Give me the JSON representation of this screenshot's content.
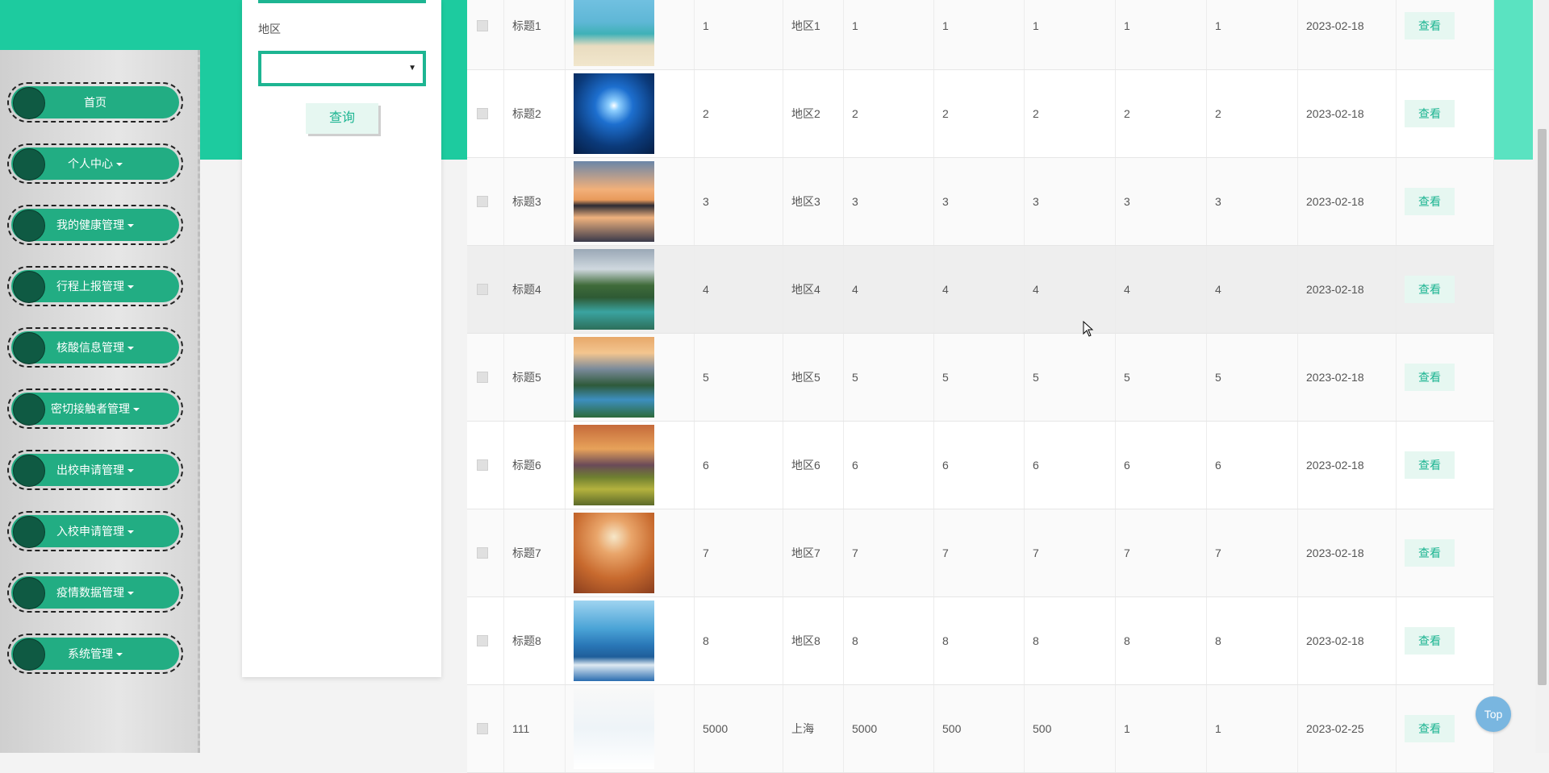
{
  "sidebar": {
    "items": [
      {
        "label": "首页",
        "dropdown": false
      },
      {
        "label": "个人中心",
        "dropdown": true
      },
      {
        "label": "我的健康管理",
        "dropdown": true
      },
      {
        "label": "行程上报管理",
        "dropdown": true
      },
      {
        "label": "核酸信息管理",
        "dropdown": true
      },
      {
        "label": "密切接触者管理",
        "dropdown": true
      },
      {
        "label": "出校申请管理",
        "dropdown": true
      },
      {
        "label": "入校申请管理",
        "dropdown": true
      },
      {
        "label": "疫情数据管理",
        "dropdown": true
      },
      {
        "label": "系统管理",
        "dropdown": true
      }
    ]
  },
  "search": {
    "region_label": "地区",
    "region_value": "",
    "query_button": "查询"
  },
  "table": {
    "rows": [
      {
        "title": "标题1",
        "c1": "1",
        "region": "地区1",
        "c2": "1",
        "c3": "1",
        "c4": "1",
        "c5": "1",
        "c6": "1",
        "date": "2023-02-18",
        "action": "查看",
        "image": "beach"
      },
      {
        "title": "标题2",
        "c1": "2",
        "region": "地区2",
        "c2": "2",
        "c3": "2",
        "c4": "2",
        "c5": "2",
        "c6": "2",
        "date": "2023-02-18",
        "action": "查看",
        "image": "blue-glacier"
      },
      {
        "title": "标题3",
        "c1": "3",
        "region": "地区3",
        "c2": "3",
        "c3": "3",
        "c4": "3",
        "c5": "3",
        "c6": "3",
        "date": "2023-02-18",
        "action": "查看",
        "image": "sunset-lake"
      },
      {
        "title": "标题4",
        "c1": "4",
        "region": "地区4",
        "c2": "4",
        "c3": "4",
        "c4": "4",
        "c5": "4",
        "c6": "4",
        "date": "2023-02-18",
        "action": "查看",
        "image": "forest-river"
      },
      {
        "title": "标题5",
        "c1": "5",
        "region": "地区5",
        "c2": "5",
        "c3": "5",
        "c4": "5",
        "c5": "5",
        "c6": "5",
        "date": "2023-02-18",
        "action": "查看",
        "image": "mountain-lake"
      },
      {
        "title": "标题6",
        "c1": "6",
        "region": "地区6",
        "c2": "6",
        "c3": "6",
        "c4": "6",
        "c5": "6",
        "c6": "6",
        "date": "2023-02-18",
        "action": "查看",
        "image": "flower-field"
      },
      {
        "title": "标题7",
        "c1": "7",
        "region": "地区7",
        "c2": "7",
        "c3": "7",
        "c4": "7",
        "c5": "7",
        "c6": "7",
        "date": "2023-02-18",
        "action": "查看",
        "image": "desert"
      },
      {
        "title": "标题8",
        "c1": "8",
        "region": "地区8",
        "c2": "8",
        "c3": "8",
        "c4": "8",
        "c5": "8",
        "c6": "8",
        "date": "2023-02-18",
        "action": "查看",
        "image": "santorini"
      },
      {
        "title": "111",
        "c1": "5000",
        "region": "上海",
        "c2": "5000",
        "c3": "500",
        "c4": "500",
        "c5": "1",
        "c6": "1",
        "date": "2023-02-25",
        "action": "查看",
        "image": "mask-cartoon"
      }
    ]
  },
  "top_button": "Top",
  "colors": {
    "accent": "#1dcb9f",
    "menu": "#22ad83",
    "button_bg": "#e6f7f1",
    "button_text": "#1db592"
  }
}
